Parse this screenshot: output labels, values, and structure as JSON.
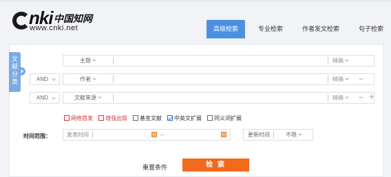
{
  "logo": {
    "cnki": "CNKI",
    "cn_name": "中国知网",
    "url": "www.cnki.net"
  },
  "tabs": [
    {
      "label": "高级检索",
      "active": true
    },
    {
      "label": "专业检索",
      "active": false
    },
    {
      "label": "作者发文检索",
      "active": false
    },
    {
      "label": "句子检索",
      "active": false
    }
  ],
  "category_tab": "文献分类",
  "search_rows": [
    {
      "logic": "",
      "field": "主题",
      "value": "",
      "match": "精确",
      "remove": "",
      "add": ""
    },
    {
      "logic": "AND",
      "field": "作者",
      "value": "",
      "match": "精确",
      "remove": "−",
      "add": ""
    },
    {
      "logic": "AND",
      "field": "文献来源",
      "value": "",
      "match": "精确",
      "remove": "−",
      "add": "+"
    }
  ],
  "checkboxes": [
    {
      "label": "网络首发",
      "checked": false,
      "color": "#dd3333"
    },
    {
      "label": "增强出版",
      "checked": false,
      "color": "#dd3333"
    },
    {
      "label": "基金文献",
      "checked": false,
      "color": "#333333"
    },
    {
      "label": "中英文扩展",
      "checked": true,
      "color": "#333333"
    },
    {
      "label": "同义词扩展",
      "checked": false,
      "color": "#333333"
    }
  ],
  "time_range": {
    "label": "时间范围：",
    "from_placeholder": "发表时间",
    "dash": "--",
    "update_label": "更新时间",
    "update_value": "不限"
  },
  "actions": {
    "reset": "重置条件",
    "search": "检 索"
  },
  "colors": {
    "accent": "#4c90e2",
    "search_button": "#f26a1b",
    "category_tab": "#7aabe1"
  }
}
